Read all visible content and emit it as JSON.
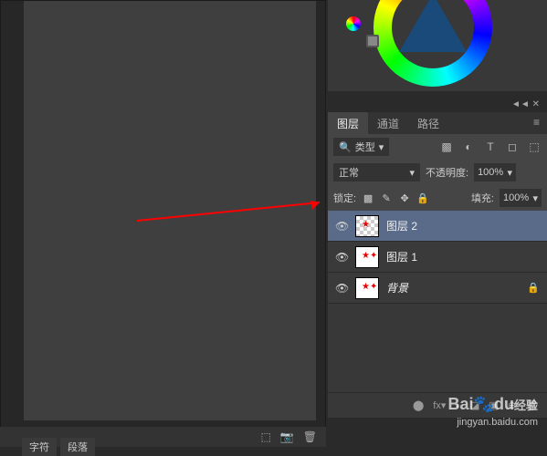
{
  "panel": {
    "collapse_icons": "◄◄ ✕"
  },
  "tabs": {
    "layers": "图层",
    "channels": "通道",
    "paths": "路径",
    "menu_icon": "≡"
  },
  "filter": {
    "search_icon": "🔍",
    "type_label": "类型",
    "dropdown_arrow": "▾",
    "icons": [
      "▩",
      "◐",
      "T",
      "◻",
      "⬚"
    ]
  },
  "blend": {
    "mode": "正常",
    "arrow": "▾",
    "opacity_label": "不透明度:",
    "opacity_value": "100%"
  },
  "lock": {
    "label": "锁定:",
    "icons": [
      "▩",
      "✎",
      "✥",
      "🔒"
    ],
    "fill_label": "填充:",
    "fill_value": "100%"
  },
  "layers": [
    {
      "name": "图层 2",
      "selected": true,
      "transparent": true,
      "locked": false
    },
    {
      "name": "图层 1",
      "selected": false,
      "transparent": false,
      "locked": false
    },
    {
      "name": "背景",
      "selected": false,
      "transparent": false,
      "locked": true,
      "italic": true
    }
  ],
  "footer_icons": [
    "⬤",
    "fx▾",
    "◐",
    "◪",
    "▣",
    "⊕",
    "🗑"
  ],
  "bottom_icons": [
    "⬚",
    "📷",
    "🗑"
  ],
  "bottom_tabs": [
    "字符",
    "段落"
  ],
  "eye_icon": "👁",
  "lock_icon": "🔒",
  "watermark": {
    "brand": "Bai",
    "brand2": "du",
    "sub": "经验",
    "url": "jingyan.baidu.com"
  }
}
